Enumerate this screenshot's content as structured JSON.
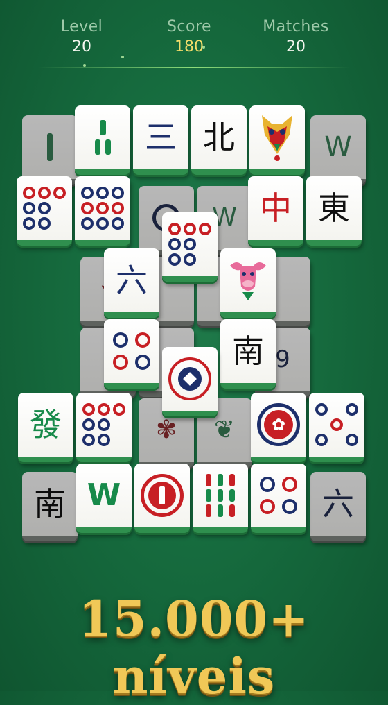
{
  "hud": {
    "level": {
      "label": "Level",
      "value": "20"
    },
    "score": {
      "label": "Score",
      "value": "180"
    },
    "matches": {
      "label": "Matches",
      "value": "20"
    }
  },
  "banner": "15.000+ níveis",
  "colors": {
    "board_green": "#166b3e",
    "tile_edge": "#2f8f4e",
    "gold": "#f0c857",
    "mahjong_red": "#c71f24",
    "mahjong_blue": "#1d2f6b",
    "mahjong_green": "#178a4a"
  },
  "tiles": {
    "san": "三",
    "bei": "北",
    "zhong": "中",
    "dong": "東",
    "liu": "六",
    "nan": "南",
    "fa": "發",
    "nan2": "南",
    "liu2": "六"
  }
}
